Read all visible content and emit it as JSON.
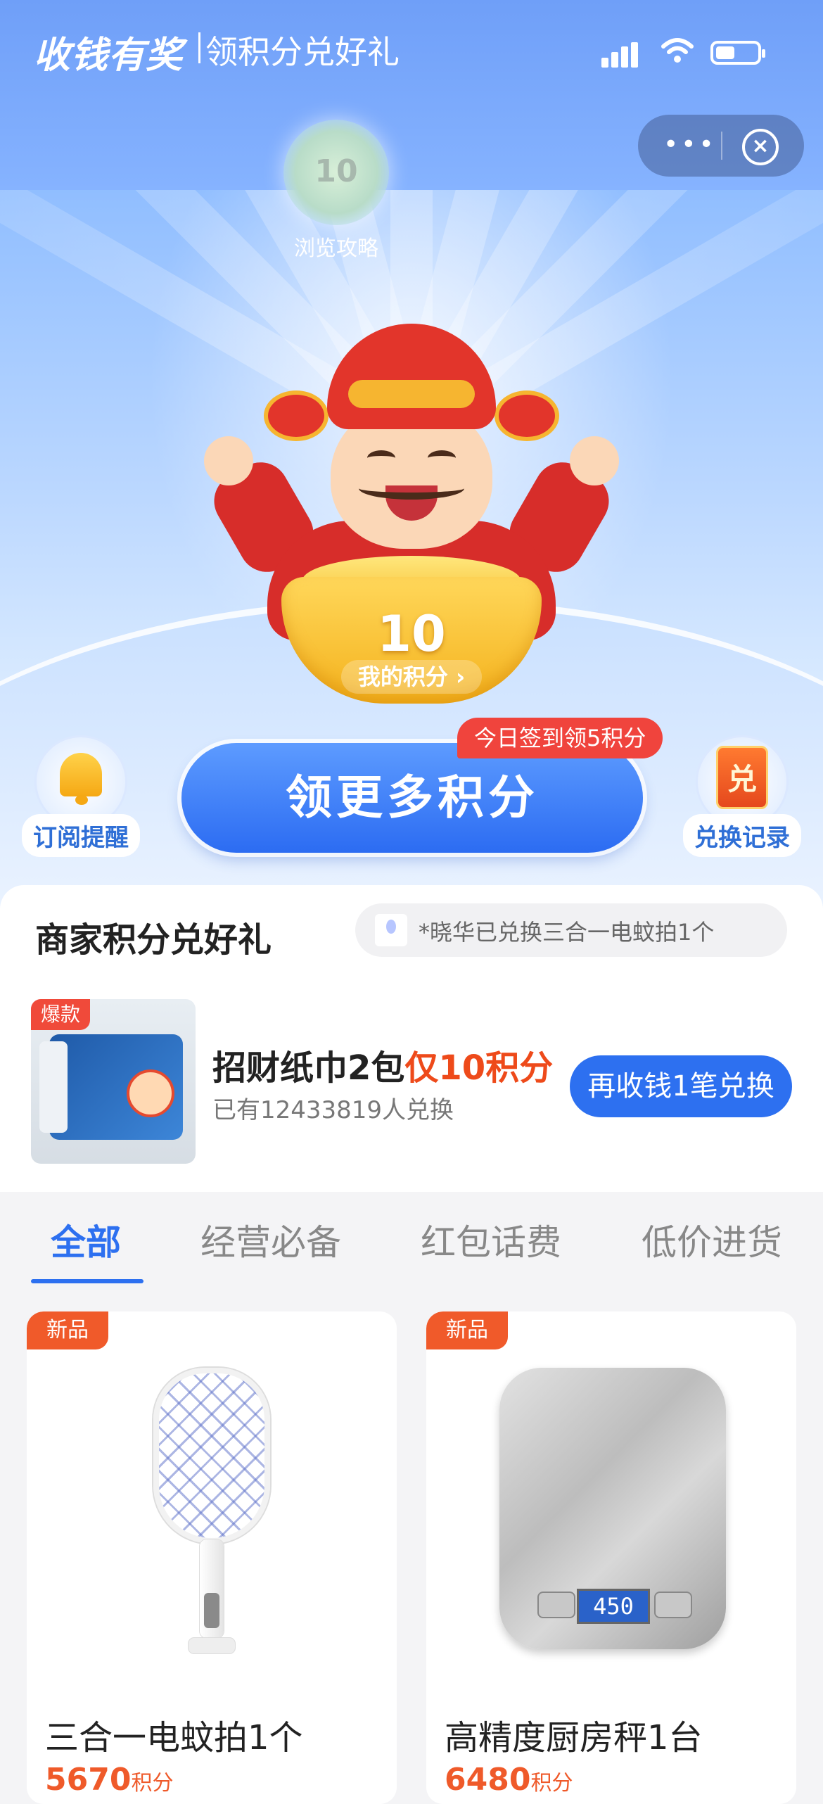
{
  "header": {
    "brand": "收钱有奖",
    "title": "领积分兑好礼"
  },
  "capsule": {
    "more": "•••",
    "close": "×"
  },
  "strategy": {
    "coin_value": "10",
    "label": "浏览攻略"
  },
  "points": {
    "value": "10",
    "label": "我的积分 ›"
  },
  "subscribe": {
    "label": "订阅提醒"
  },
  "exchange_record": {
    "icon_char": "兑",
    "label": "兑换记录"
  },
  "cta": {
    "label": "领更多积分",
    "badge": "今日签到领5积分"
  },
  "merchant": {
    "title": "商家积分兑好礼",
    "ticker": "*晓华已兑换三合一电蚊拍1个",
    "featured": {
      "tag": "爆款",
      "name": "招财纸巾2包",
      "price_highlight": "仅10积分",
      "subtitle": "已有12433819人兑换",
      "button": "再收钱1笔兑换"
    }
  },
  "tabs": [
    "全部",
    "经营必备",
    "红包话费",
    "低价进货"
  ],
  "products": [
    {
      "tag": "新品",
      "name": "三合一电蚊拍1个",
      "price": "5670",
      "unit": "积分"
    },
    {
      "tag": "新品",
      "name": "高精度厨房秤1台",
      "price": "6480",
      "unit": "积分",
      "display": "450"
    }
  ]
}
